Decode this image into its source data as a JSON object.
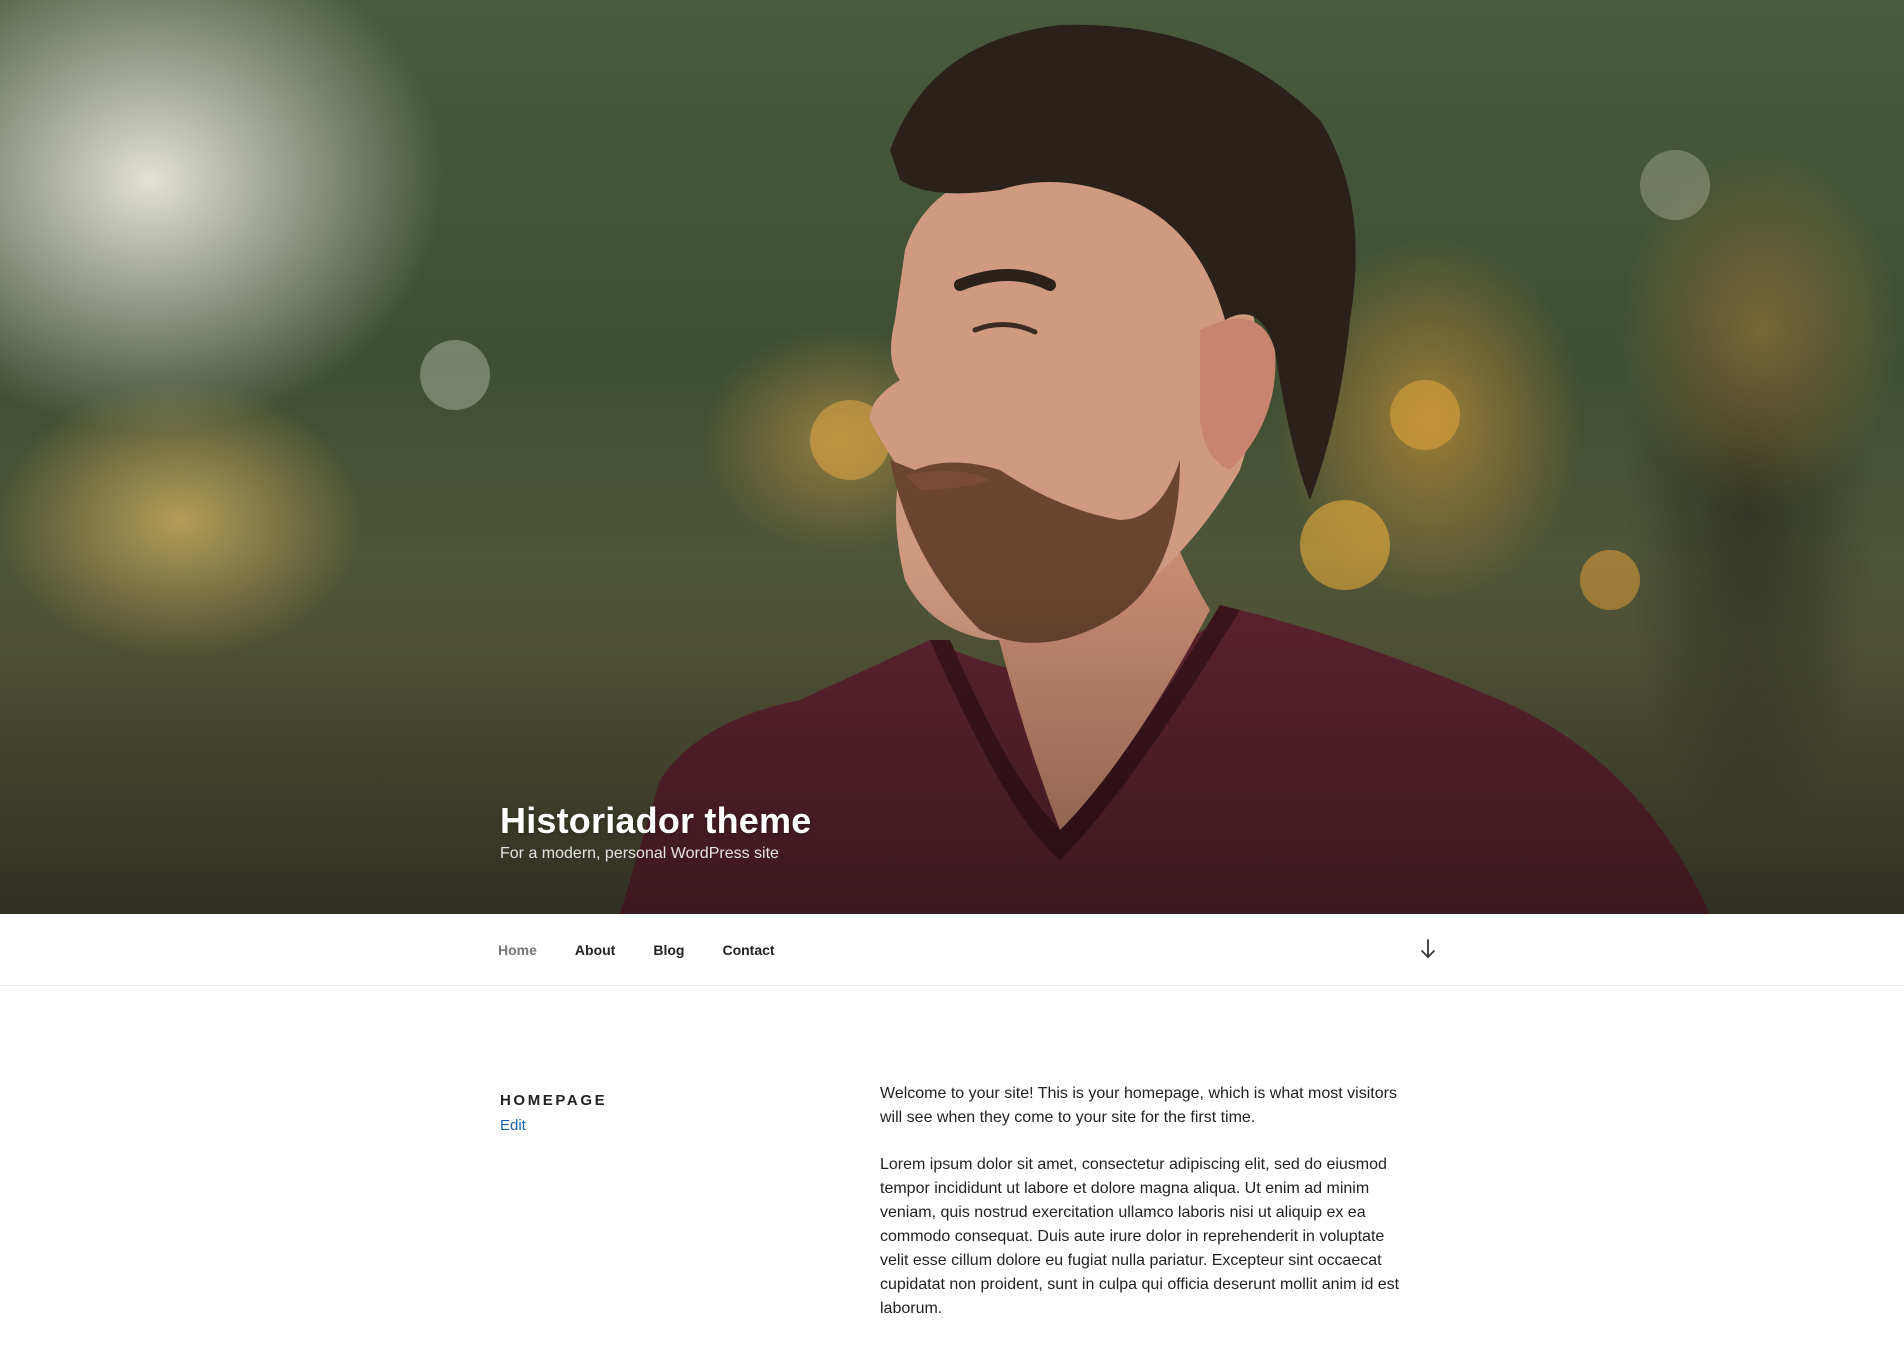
{
  "site": {
    "title": "Historiador theme",
    "description": "For a modern, personal WordPress site"
  },
  "nav": {
    "items": [
      {
        "label": "Home",
        "current": true
      },
      {
        "label": "About",
        "current": false
      },
      {
        "label": "Blog",
        "current": false
      },
      {
        "label": "Contact",
        "current": false
      }
    ],
    "scroll_icon": "arrow-down-icon"
  },
  "page": {
    "title": "HOMEPAGE",
    "edit_label": "Edit",
    "paragraphs": [
      "Welcome to your site! This is your homepage, which is what most visitors will see when they come to your site for the first time.",
      "Lorem ipsum dolor sit amet, consectetur adipiscing elit, sed do eiusmod tempor incididunt ut labore et dolore magna aliqua. Ut enim ad minim veniam, quis nostrud exercitation ullamco laboris nisi ut aliquip ex ea commodo consequat. Duis aute irure dolor in reprehenderit in voluptate velit esse cillum dolore eu fugiat nulla pariatur. Excepteur sint occaecat cupidatat non proident, sunt in culpa qui officia deserunt mollit anim id est laborum."
    ]
  },
  "colors": {
    "link": "#1a5fa8",
    "text": "#222222",
    "nav_current": "#767676",
    "shirt": "#5e2430"
  }
}
